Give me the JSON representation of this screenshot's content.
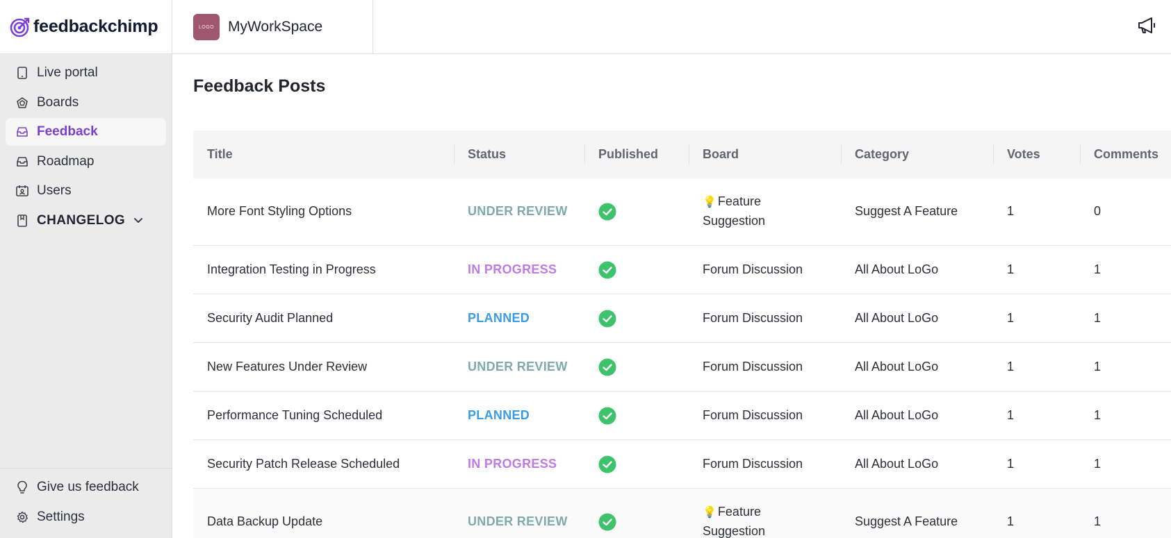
{
  "brand": {
    "name": "feedbackchimp",
    "color": "#7b3fd0"
  },
  "sidebar": {
    "items": [
      {
        "label": "Live portal",
        "icon": "tablet-icon"
      },
      {
        "label": "Boards",
        "icon": "boards-icon"
      },
      {
        "label": "Feedback",
        "icon": "inbox-icon",
        "active": true
      },
      {
        "label": "Roadmap",
        "icon": "inbox-icon"
      },
      {
        "label": "Users",
        "icon": "users-icon"
      },
      {
        "label": "CHANGELOG",
        "icon": "book-icon"
      }
    ],
    "bottom": [
      {
        "label": "Give us feedback",
        "icon": "lightbulb-icon"
      },
      {
        "label": "Settings",
        "icon": "gear-icon"
      }
    ]
  },
  "topbar": {
    "workspace_name": "MyWorkSpace",
    "workspace_logo_text": "LOGO"
  },
  "main": {
    "title": "Feedback Posts",
    "columns": [
      "Title",
      "Status",
      "Published",
      "Board",
      "Category",
      "Votes",
      "Comments"
    ],
    "rows": [
      {
        "title": "More Font Styling Options",
        "status": "UNDER REVIEW",
        "board_line1": "Feature",
        "board_line2": "Suggestion",
        "category": "Suggest A Feature",
        "votes": "1",
        "comments": "0"
      },
      {
        "title": "Integration Testing in Progress",
        "status": "IN PROGRESS",
        "board": "Forum Discussion",
        "category": "All About LoGo",
        "votes": "1",
        "comments": "1"
      },
      {
        "title": "Security Audit Planned",
        "status": "PLANNED",
        "board": "Forum Discussion",
        "category": "All About LoGo",
        "votes": "1",
        "comments": "1"
      },
      {
        "title": "New Features Under Review",
        "status": "UNDER REVIEW",
        "board": "Forum Discussion",
        "category": "All About LoGo",
        "votes": "1",
        "comments": "1"
      },
      {
        "title": "Performance Tuning Scheduled",
        "status": "PLANNED",
        "board": "Forum Discussion",
        "category": "All About LoGo",
        "votes": "1",
        "comments": "1"
      },
      {
        "title": "Security Patch Release Scheduled",
        "status": "IN PROGRESS",
        "board": "Forum Discussion",
        "category": "All About LoGo",
        "votes": "1",
        "comments": "1"
      },
      {
        "title": "Data Backup Update",
        "status": "UNDER REVIEW",
        "board_line1": "Feature",
        "board_line2": "Suggestion",
        "category": "Suggest A Feature",
        "votes": "1",
        "comments": "1"
      }
    ]
  },
  "colors": {
    "under_review": "#7fa9ab",
    "in_progress": "#c07ae6",
    "planned": "#3a9be6",
    "published_check": "#3ec26b"
  }
}
